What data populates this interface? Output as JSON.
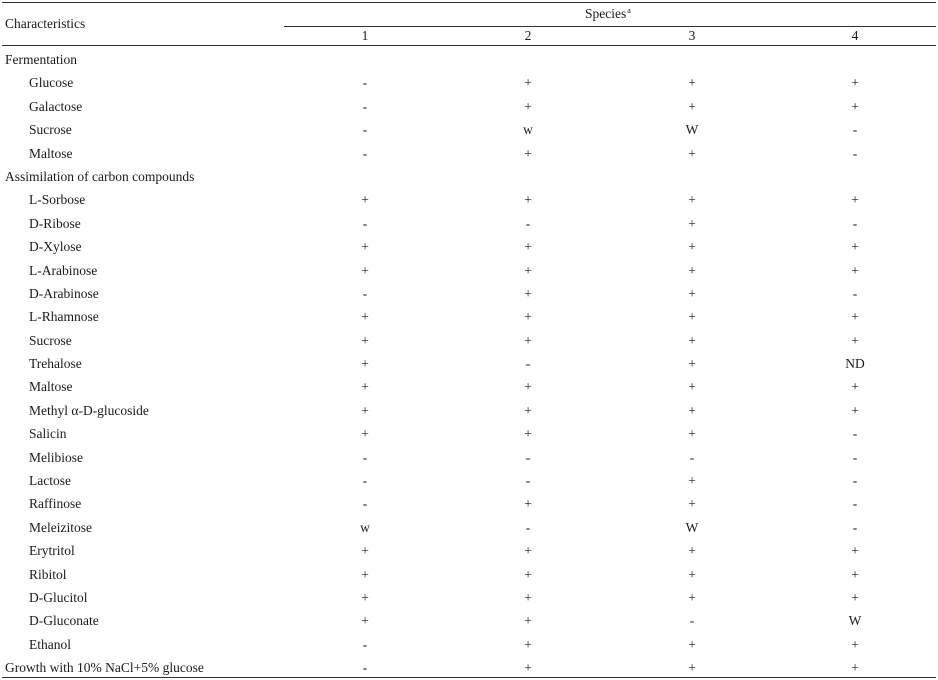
{
  "header": {
    "characteristics": "Characteristics",
    "species": "Species",
    "species_sup": "a",
    "columns": [
      "1",
      "2",
      "3",
      "4"
    ]
  },
  "rows": [
    {
      "label": "Fermentation",
      "section": true,
      "values": [
        "",
        "",
        "",
        ""
      ]
    },
    {
      "label": "Glucose",
      "values": [
        "-",
        "+",
        "+",
        "+"
      ]
    },
    {
      "label": "Galactose",
      "values": [
        "-",
        "+",
        "+",
        "+"
      ]
    },
    {
      "label": "Sucrose",
      "values": [
        "-",
        "w",
        "W",
        "-"
      ]
    },
    {
      "label": "Maltose",
      "values": [
        "-",
        "+",
        "+",
        "-"
      ]
    },
    {
      "label": "Assimilation of carbon compounds",
      "section": true,
      "values": [
        "",
        "",
        "",
        ""
      ]
    },
    {
      "label": "L-Sorbose",
      "values": [
        "+",
        "+",
        "+",
        "+"
      ]
    },
    {
      "label": "D-Ribose",
      "values": [
        "-",
        "-",
        "+",
        "-"
      ]
    },
    {
      "label": "D-Xylose",
      "values": [
        "+",
        "+",
        "+",
        "+"
      ]
    },
    {
      "label": "L-Arabinose",
      "values": [
        "+",
        "+",
        "+",
        "+"
      ]
    },
    {
      "label": "D-Arabinose",
      "values": [
        "-",
        "+",
        "+",
        "-"
      ]
    },
    {
      "label": "L-Rhamnose",
      "values": [
        "+",
        "+",
        "+",
        "+"
      ]
    },
    {
      "label": "Sucrose",
      "values": [
        "+",
        "+",
        "+",
        "+"
      ]
    },
    {
      "label": "Trehalose",
      "values": [
        "+",
        "-",
        "+",
        "ND"
      ]
    },
    {
      "label": "Maltose",
      "values": [
        "+",
        "+",
        "+",
        "+"
      ]
    },
    {
      "label": "Methyl α-D-glucoside",
      "values": [
        "+",
        "+",
        "+",
        "+"
      ]
    },
    {
      "label": "Salicin",
      "values": [
        "+",
        "+",
        "+",
        "-"
      ]
    },
    {
      "label": "Melibiose",
      "values": [
        "-",
        "-",
        "-",
        "-"
      ]
    },
    {
      "label": "Lactose",
      "values": [
        "-",
        "-",
        "+",
        "-"
      ]
    },
    {
      "label": "Raffinose",
      "values": [
        "-",
        "+",
        "+",
        "-"
      ]
    },
    {
      "label": "Meleizitose",
      "values": [
        "w",
        "-",
        "W",
        "-"
      ]
    },
    {
      "label": "Erytritol",
      "values": [
        "+",
        "+",
        "+",
        "+"
      ]
    },
    {
      "label": "Ribitol",
      "values": [
        "+",
        "+",
        "+",
        "+"
      ]
    },
    {
      "label": "D-Glucitol",
      "values": [
        "+",
        "+",
        "+",
        "+"
      ]
    },
    {
      "label": "D-Gluconate",
      "values": [
        "+",
        "+",
        "-",
        "W"
      ]
    },
    {
      "label": "Ethanol",
      "values": [
        "-",
        "+",
        "+",
        "+"
      ]
    },
    {
      "label": "Growth with 10% NaCl+5% glucose",
      "section": true,
      "values": [
        "-",
        "+",
        "+",
        "+"
      ]
    }
  ]
}
